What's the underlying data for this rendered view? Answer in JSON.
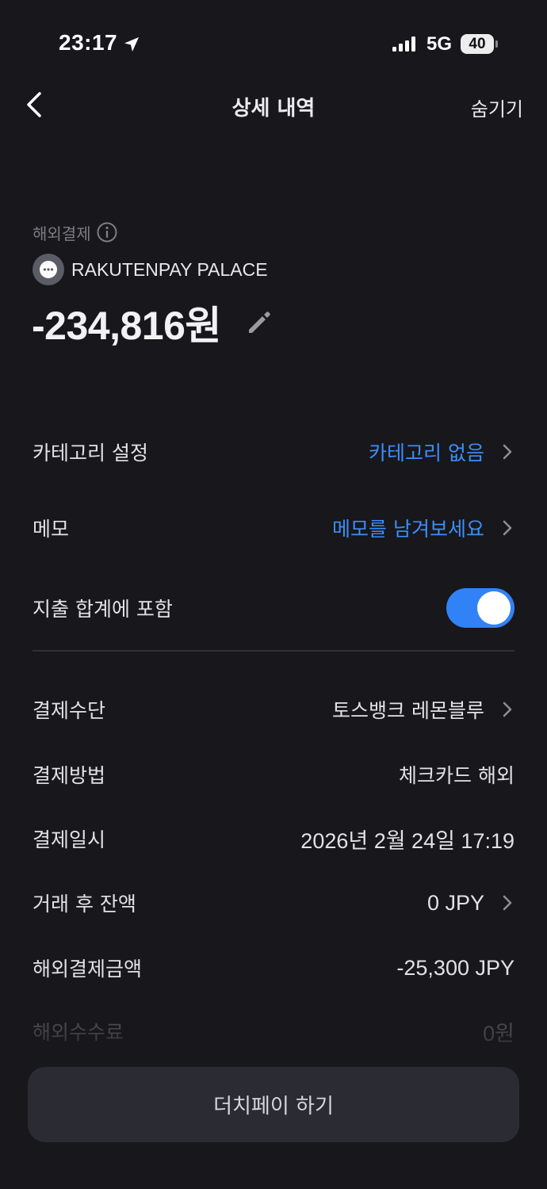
{
  "status_bar": {
    "time": "23:17",
    "network": "5G",
    "battery": "40"
  },
  "nav": {
    "title": "상세 내역",
    "hide_label": "숨기기"
  },
  "transaction": {
    "type_label": "해외결제",
    "merchant": "RAKUTENPAY PALACE",
    "amount": "-234,816원"
  },
  "settings": {
    "category_label": "카테고리 설정",
    "category_value": "카테고리 없음",
    "memo_label": "메모",
    "memo_placeholder": "메모를 남겨보세요",
    "include_total_label": "지출 합계에 포함",
    "include_total_on": true
  },
  "details": [
    {
      "label": "결제수단",
      "value": "토스뱅크 레몬블루"
    },
    {
      "label": "결제방법",
      "value": "체크카드 해외"
    },
    {
      "label": "결제일시",
      "value": "2026년 2월 24일 17:19"
    },
    {
      "label": "거래 후 잔액",
      "value": "0 JPY"
    },
    {
      "label": "해외결제금액",
      "value": "-25,300 JPY"
    },
    {
      "label": "해외수수료",
      "value": "0원"
    }
  ],
  "actions": {
    "dutch_pay": "더치페이 하기"
  },
  "colors": {
    "background": "#17171c",
    "accent": "#3182f6",
    "link": "#3d8ef7"
  }
}
